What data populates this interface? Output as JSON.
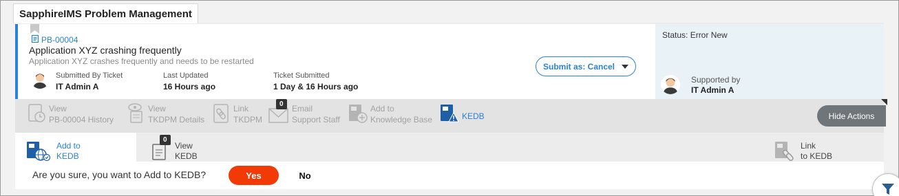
{
  "app": {
    "title": "SapphireIMS Problem Management"
  },
  "ticket": {
    "id": "PB-00004",
    "title": "Application XYZ crashing frequently",
    "description": "Application XYZ crashes frequently and needs to be restarted",
    "submitted_by_label": "Submitted By Ticket",
    "submitted_by_value": "IT Admin A",
    "last_updated_label": "Last Updated",
    "last_updated_value": "16 Hours ago",
    "ticket_submitted_label": "Ticket Submitted",
    "ticket_submitted_value": "1 Day & 16 Hours ago",
    "submit_button": "Submit as: Cancel"
  },
  "status_panel": {
    "status": "Status: Error New",
    "supported_by_label": "Supported by",
    "supported_by_value": "IT Admin A"
  },
  "actions": {
    "view_history_line1": "View",
    "view_history_line2": "PB-00004 History",
    "view_tkdpm_line1": "View",
    "view_tkdpm_line2": "TKDPM Details",
    "link_tkdpm_line1": "Link",
    "link_tkdpm_line2": "TKDPM",
    "email_line1": "Email",
    "email_line2": "Support Staff",
    "email_badge": "0",
    "add_kb_line1": "Add to",
    "add_kb_line2": "Knowledge Base",
    "kedb": "KEDB",
    "hide_actions": "Hide Actions"
  },
  "kedb_tabs": {
    "add_line1": "Add to",
    "add_line2": "KEDB",
    "view_line1": "View",
    "view_line2": "KEDB",
    "view_badge": "0",
    "link_line1": "Link",
    "link_line2": "to KEDB"
  },
  "confirm": {
    "question": "Are you sure, you want to Add to KEDB?",
    "yes": "Yes",
    "no": "No"
  },
  "colors": {
    "accent": "#2a82d6",
    "danger": "#f23a06",
    "status_panel_bg": "#e9f3f7",
    "action_bar_bg": "#e3e3e3"
  },
  "icons": [
    "document-icon",
    "avatar-icon",
    "history-icon",
    "view-details-icon",
    "link-icon",
    "email-icon",
    "knowledge-base-add-icon",
    "kedb-warning-icon",
    "kedb-add-icon",
    "kedb-view-icon",
    "kedb-link-icon",
    "filter-icon",
    "chevron-down-icon"
  ]
}
